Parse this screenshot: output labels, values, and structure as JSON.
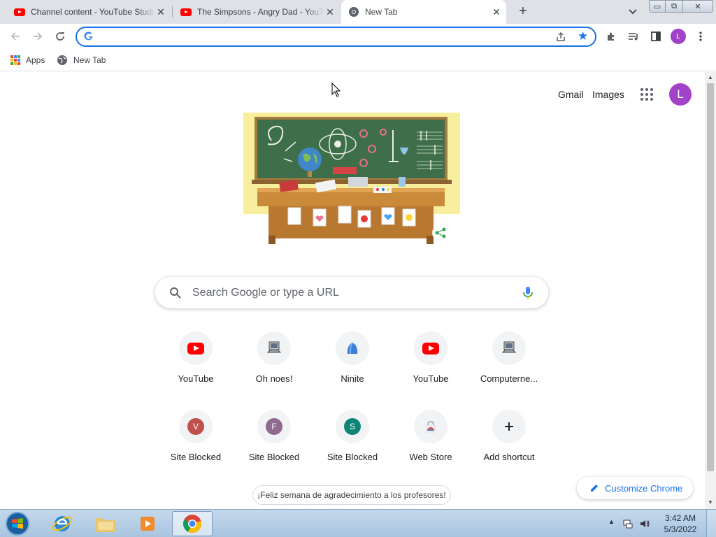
{
  "tabs": [
    {
      "title": "Channel content - YouTube Studio",
      "favicon": "youtube-icon",
      "close": "✕"
    },
    {
      "title": "The Simpsons - Angry Dad - YouTube",
      "favicon": "youtube-icon",
      "close": "✕"
    },
    {
      "title": "New Tab",
      "favicon": "chrome-icon",
      "close": "✕",
      "active": true
    }
  ],
  "new_tab_symbol": "+",
  "window_controls": {
    "minimize": "▭",
    "maximize": "⧉",
    "close": "✕"
  },
  "toolbar": {
    "omnibox_value": "",
    "profile_initial": "L"
  },
  "bookmarks": [
    {
      "label": "Apps",
      "icon": "apps-grid-icon"
    },
    {
      "label": "New Tab",
      "icon": "globe-icon"
    }
  ],
  "page": {
    "gmail": "Gmail",
    "images": "Images",
    "avatar_initial": "L",
    "search_placeholder": "Search Google or type a URL",
    "shortcuts": [
      {
        "label": "YouTube",
        "icon": "youtube-icon"
      },
      {
        "label": "Oh noes!",
        "icon": "computer-icon"
      },
      {
        "label": "Ninite",
        "icon": "ninite-icon"
      },
      {
        "label": "YouTube",
        "icon": "youtube-icon"
      },
      {
        "label": "Computerne...",
        "icon": "computer-icon"
      },
      {
        "label": "Site Blocked",
        "letter": "V",
        "color": "#c0504d"
      },
      {
        "label": "Site Blocked",
        "letter": "F",
        "color": "#8e6a8e"
      },
      {
        "label": "Site Blocked",
        "letter": "S",
        "color": "#108577"
      },
      {
        "label": "Web Store",
        "icon": "webstore-icon"
      },
      {
        "label": "Add shortcut",
        "icon": "plus-icon"
      }
    ],
    "promo_text": "¡Feliz semana de agradecimiento a los profesores!",
    "customize_label": "Customize Chrome"
  },
  "taskbar": {
    "time": "3:42 AM",
    "date": "5/3/2022",
    "apps": [
      "internet-explorer-icon",
      "file-explorer-icon",
      "media-player-icon",
      "chrome-icon"
    ]
  },
  "colors": {
    "accent": "#1a73e8",
    "avatar": "#a142c8",
    "tabstrip": "#dee1e6",
    "youtube_red": "#ff0000"
  }
}
